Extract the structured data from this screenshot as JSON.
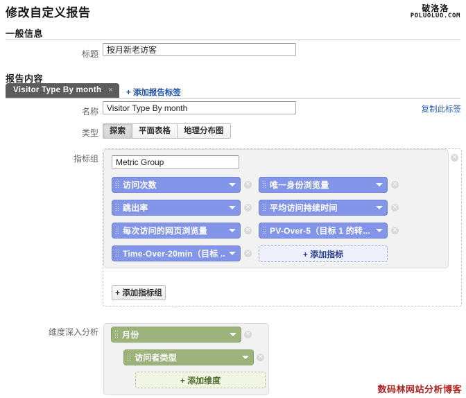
{
  "watermark": {
    "cn": "破洛洛",
    "en": "POLUOLUO.COM"
  },
  "blog_mark": "数码林网站分析博客",
  "page_title": "修改自定义报告",
  "sections": {
    "general": {
      "heading": "一般信息"
    },
    "content": {
      "heading": "报告内容"
    }
  },
  "general_form": {
    "title_label": "标题",
    "title_value": "按月新老访客",
    "title_placeholder": ""
  },
  "tabs": {
    "items": [
      {
        "label": "Visitor Type By month",
        "close": "×"
      }
    ],
    "add_tab_label": "+ 添加报告标签",
    "copy_tab_label": "复制此标签"
  },
  "report_form": {
    "name_label": "名称",
    "name_value": "Visitor Type By month",
    "name_placeholder": "",
    "type_label": "类型",
    "type_options": [
      "探索",
      "平面表格",
      "地理分布图"
    ],
    "type_selected": "探索"
  },
  "metric_section": {
    "label": "指标组",
    "group_name_value": "Metric Group",
    "group_name_placeholder": "",
    "remove_group_icon": "×",
    "left_column": [
      {
        "label": "访问次数",
        "remove": "×"
      },
      {
        "label": "跳出率",
        "remove": "×"
      },
      {
        "label": "每次访问的网页浏览量",
        "remove": "×"
      },
      {
        "label": "Time-Over-20min（目标 ...",
        "remove": "×"
      }
    ],
    "right_column": [
      {
        "label": "唯一身份浏览量",
        "remove": "×"
      },
      {
        "label": "平均访问持续时间",
        "remove": "×"
      },
      {
        "label": "PV-Over-5（目标 1 的转...",
        "remove": "×"
      }
    ],
    "add_metric_label": "+ 添加指标",
    "add_metric_group_label": "+ 添加指标组"
  },
  "dimension_section": {
    "label": "维度深入分析",
    "items": [
      {
        "label": "月份",
        "remove": "×"
      },
      {
        "label": "访问者类型",
        "remove": "×"
      }
    ],
    "add_dimension_label": "+ 添加维度"
  },
  "colors": {
    "metric_pill": "#8295e8",
    "dimension_pill": "#9cb37b",
    "link": "#2a5db0",
    "tab_active_bg": "#5b5b5b",
    "blog_mark": "#b11f1f"
  }
}
